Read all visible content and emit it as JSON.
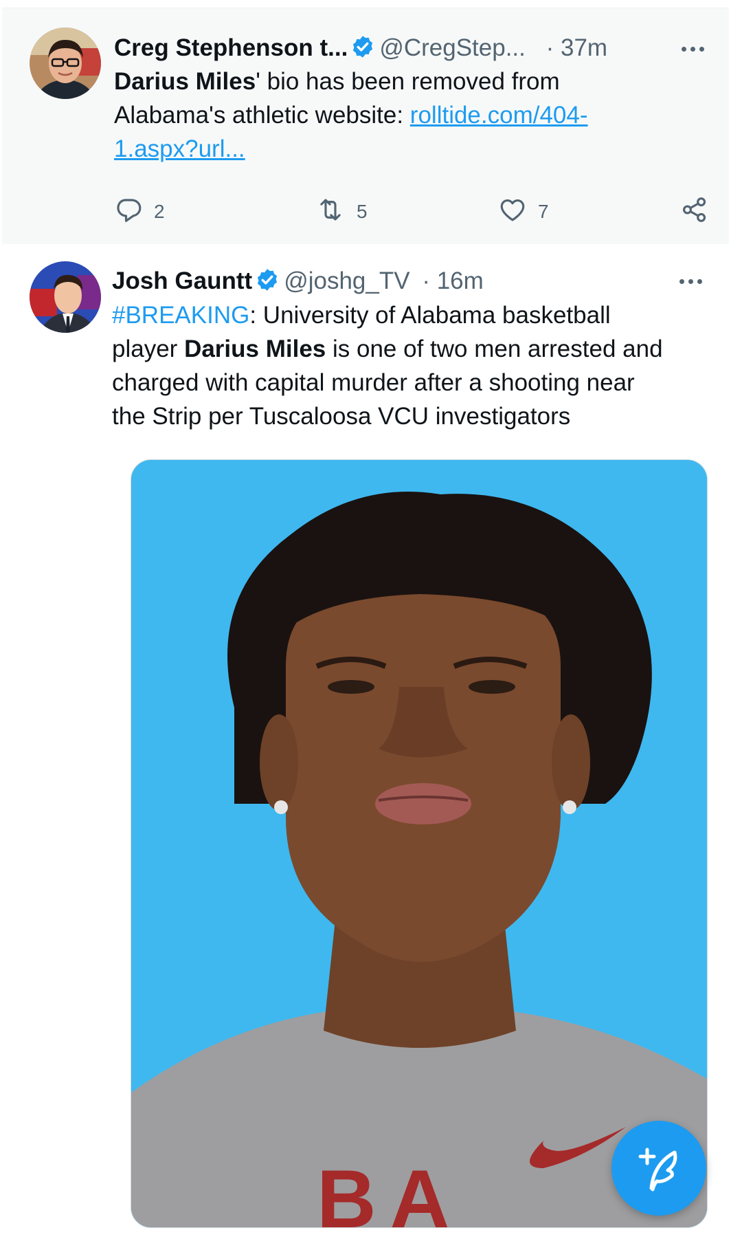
{
  "tweets": [
    {
      "display_name": "Creg Stephenson t...",
      "handle": "@CregStep...",
      "time": "· 37m",
      "text_bold": "Darius Miles",
      "text_rest": "' bio has been removed from",
      "text_line2": "Alabama's athletic website: ",
      "link_line1": "rolltide.com/404-",
      "link_line2": "1.aspx?url...",
      "replies": "2",
      "retweets": "5",
      "likes": "7"
    },
    {
      "display_name": "Josh Gauntt",
      "handle": "@joshg_TV",
      "time": "· 16m",
      "hashtag": "#BREAKING",
      "line1_rest": ": University of Alabama basketball",
      "line2_pre": "player ",
      "line2_bold": "Darius Miles",
      "line2_post": " is one of two men arrested and",
      "line3": "charged with capital murder after a shooting near",
      "line4": "the Strip per Tuscaloosa VCU investigators",
      "shirt_text": "BA"
    }
  ],
  "colors": {
    "accent": "#1d9bf0",
    "muted": "#536471",
    "text": "#0f1419",
    "photo_background": "#3fb8ef"
  },
  "icons": [
    "verified-badge-icon",
    "more-icon",
    "reply-icon",
    "retweet-icon",
    "like-icon",
    "share-icon",
    "compose-tweet-icon"
  ]
}
